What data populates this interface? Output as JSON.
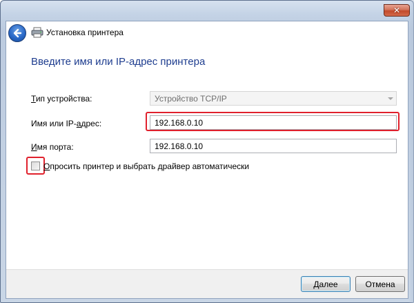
{
  "window": {
    "title": "Установка принтера",
    "close_glyph": "✕"
  },
  "main": {
    "heading": "Введите имя или IP-адрес принтера",
    "device_type": {
      "label_underlined": "Т",
      "label_rest": "ип устройства:",
      "value": "Устройство TCP/IP"
    },
    "address": {
      "label_pre": "Имя или IP-",
      "label_underlined": "а",
      "label_rest": "дрес:",
      "value": "192.168.0.10"
    },
    "port": {
      "label_underlined": "И",
      "label_rest": "мя порта:",
      "value": "192.168.0.10"
    },
    "auto_driver": {
      "label_underlined": "О",
      "label_rest": "просить принтер и выбрать драйвер автоматически",
      "checked": false
    }
  },
  "footer": {
    "next_label_underlined": "Д",
    "next_label_rest": "алее",
    "cancel_label": "Отмена"
  },
  "colors": {
    "heading": "#1e3d8f",
    "highlight": "#e0202c",
    "back_button": "#2a69c8"
  },
  "icons": {
    "back": "back-arrow-icon",
    "printer": "printer-icon",
    "close": "close-icon"
  }
}
